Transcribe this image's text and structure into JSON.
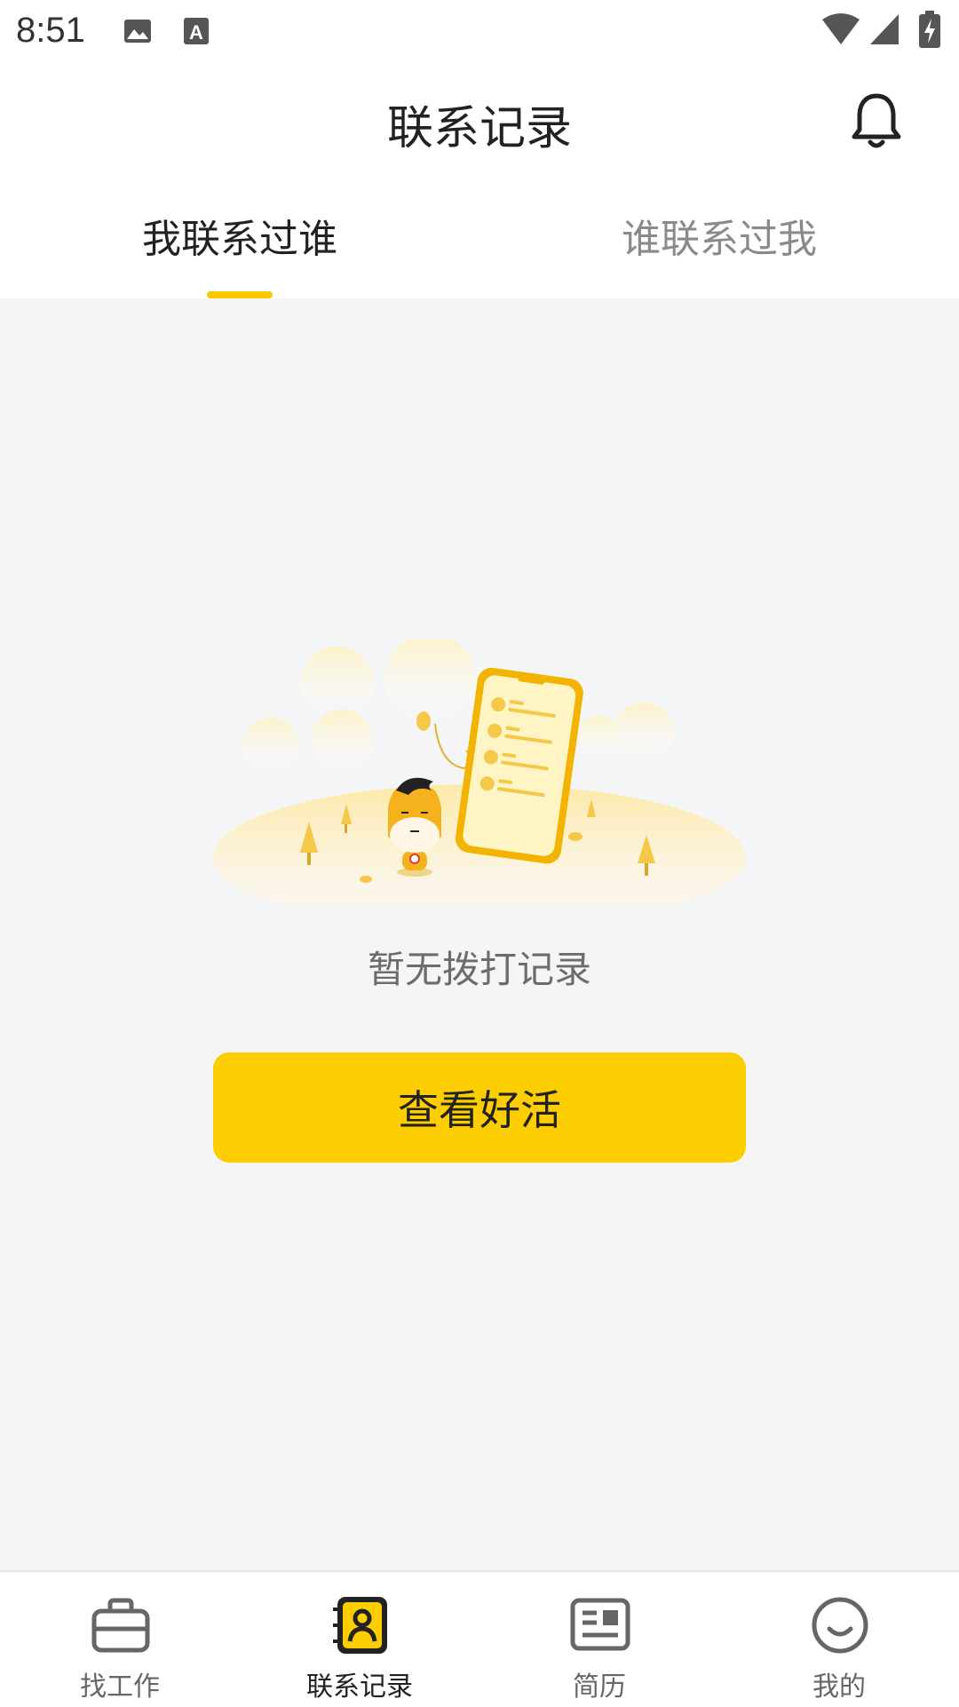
{
  "status_bar": {
    "time": "8:51",
    "icons": [
      "image-icon",
      "text-a-icon",
      "wifi-icon",
      "signal-icon",
      "battery-charging-icon"
    ]
  },
  "header": {
    "title": "联系记录",
    "bell_icon": "bell-icon"
  },
  "tabs": [
    {
      "label": "我联系过谁",
      "active": true
    },
    {
      "label": "谁联系过我",
      "active": false
    }
  ],
  "empty_state": {
    "message": "暂无拨打记录",
    "button_label": "查看好活"
  },
  "bottom_nav": [
    {
      "label": "找工作",
      "icon": "briefcase-icon",
      "active": false
    },
    {
      "label": "联系记录",
      "icon": "contacts-book-icon",
      "active": true
    },
    {
      "label": "简历",
      "icon": "resume-icon",
      "active": false
    },
    {
      "label": "我的",
      "icon": "smile-face-icon",
      "active": false
    }
  ],
  "colors": {
    "accent": "#fccd00",
    "background": "#f4f5f7",
    "text_primary": "#222222",
    "text_secondary": "#8a8a8a"
  }
}
